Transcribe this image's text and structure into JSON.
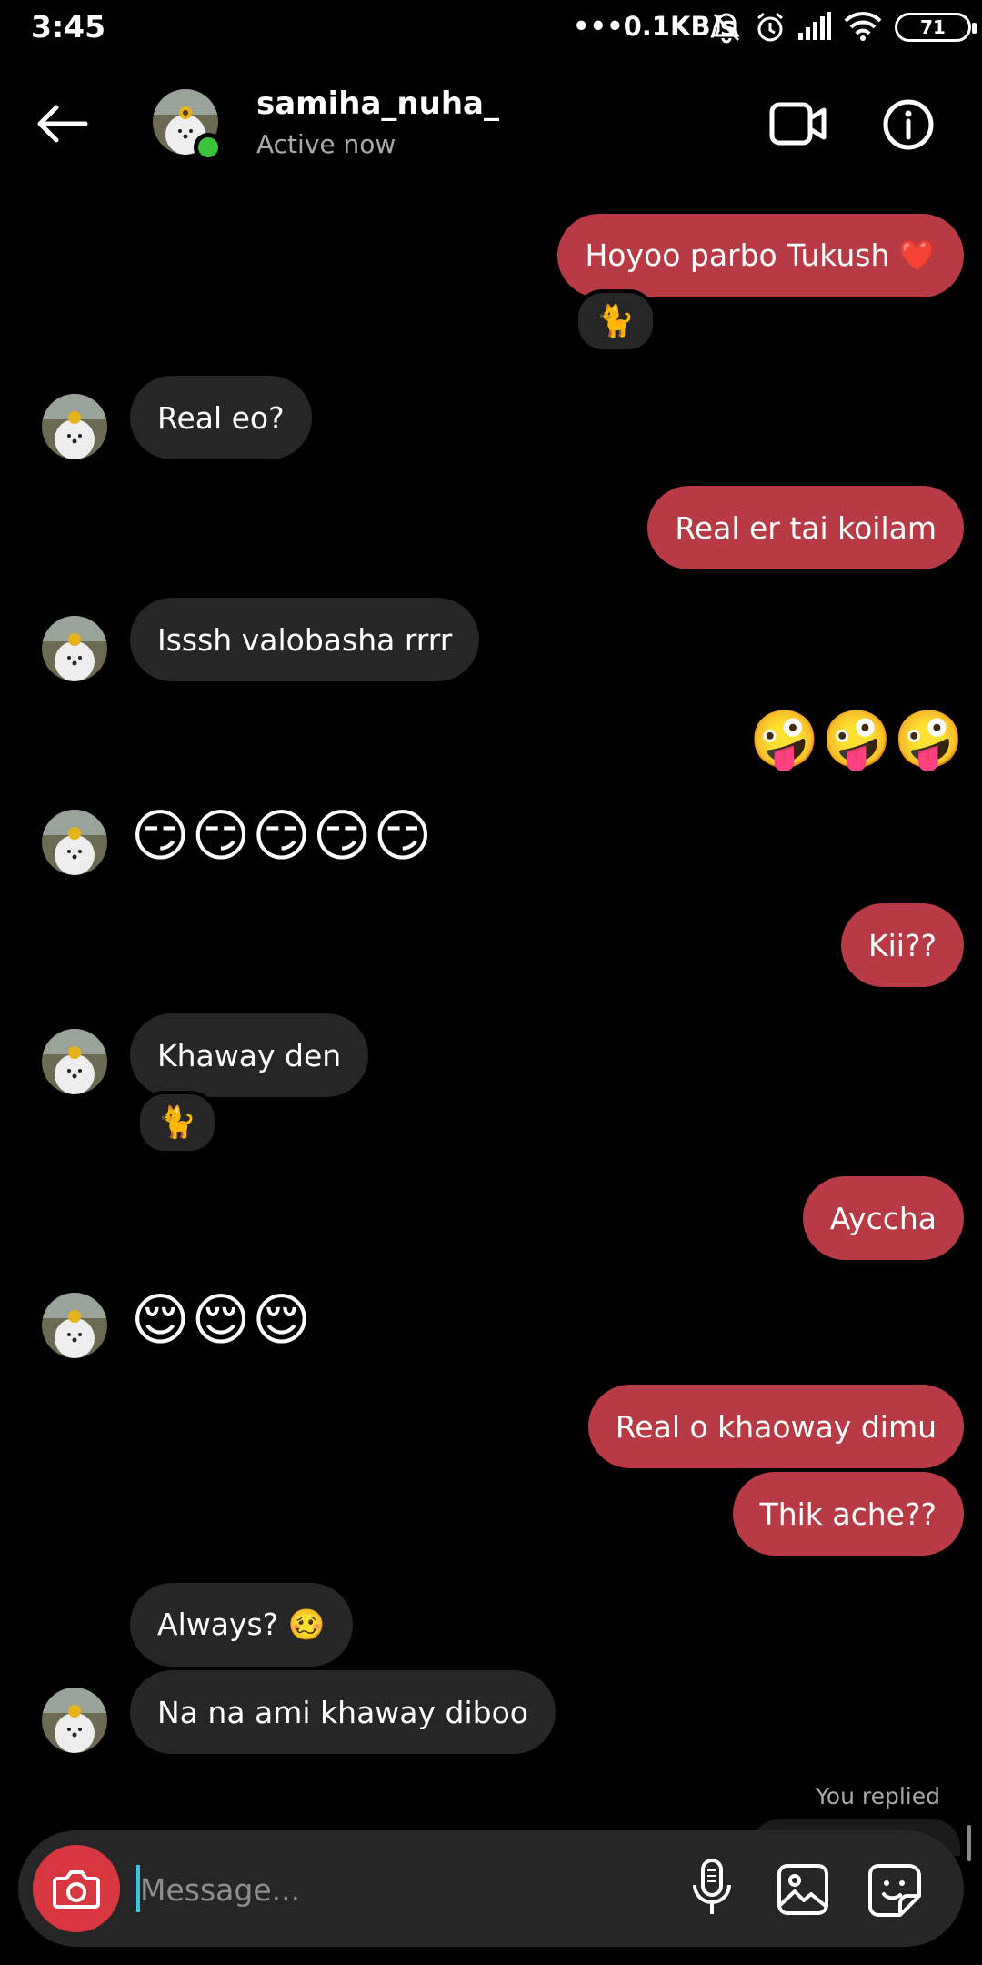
{
  "status": {
    "time": "3:45",
    "net_speed": "0.1KB/s",
    "battery": "71"
  },
  "header": {
    "username": "samiha_nuha_",
    "subtitle": "Active now"
  },
  "messages": {
    "m1": "Hoyoo parbo Tukush ❤️",
    "m1_reaction": "🐈",
    "m2": "Real eo?",
    "m3": "Real er tai koilam",
    "m4": "Isssh valobasha rrrr",
    "m5": "🤪🤪🤪",
    "m6": "😏😏😏😏😏",
    "m7": "Kii??",
    "m8": "Khaway den",
    "m8_reaction": "🐈",
    "m9": "Ayccha",
    "m10": "😌😌😌",
    "m11": "Real o khaoway dimu",
    "m12": "Thik ache??",
    "m13": "Always? 🥴",
    "m14": "Na na ami khaway diboo",
    "you_replied": "You replied"
  },
  "composer": {
    "placeholder": "Message..."
  },
  "icons": {
    "back": "arrow-left-icon",
    "video": "video-call-icon",
    "info": "info-icon",
    "camera": "camera-icon",
    "mic": "microphone-icon",
    "gallery": "image-icon",
    "sticker": "sticker-icon"
  },
  "colors": {
    "outgoing_bubble": "#b83a44",
    "incoming_bubble": "#262626",
    "online_dot": "#3cc33c",
    "camera_button": "#d9373f"
  }
}
